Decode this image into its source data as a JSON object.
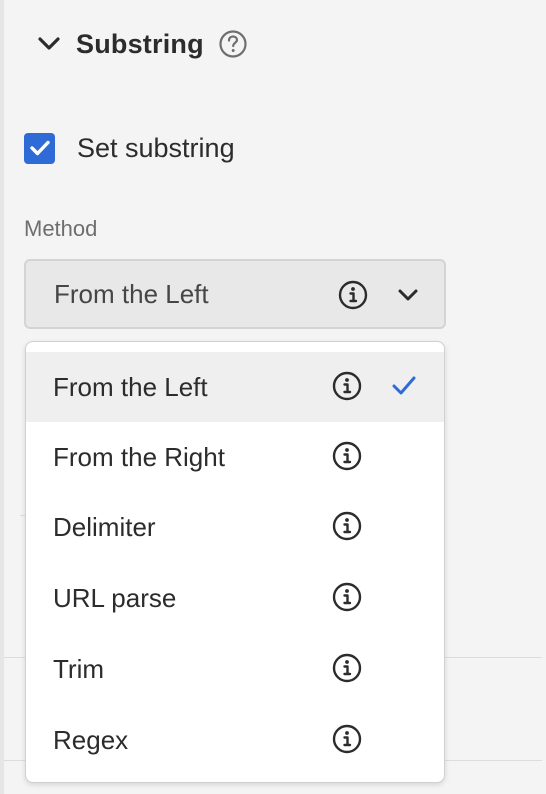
{
  "section": {
    "title": "Substring",
    "expand_icon": "chevron-down-icon",
    "help_icon": "help-circle-icon"
  },
  "substring_toggle": {
    "label": "Set substring",
    "checked": true,
    "accent_color": "#2f6bd6"
  },
  "method": {
    "label": "Method",
    "selected_value": "From the Left",
    "info_icon": "info-icon",
    "dropdown_icon": "chevron-down-icon",
    "options": [
      {
        "label": "From the Left",
        "selected": true
      },
      {
        "label": "From the Right",
        "selected": false
      },
      {
        "label": "Delimiter",
        "selected": false
      },
      {
        "label": "URL parse",
        "selected": false
      },
      {
        "label": "Trim",
        "selected": false
      },
      {
        "label": "Regex",
        "selected": false
      }
    ],
    "selected_check_color": "#2f6bd6"
  }
}
